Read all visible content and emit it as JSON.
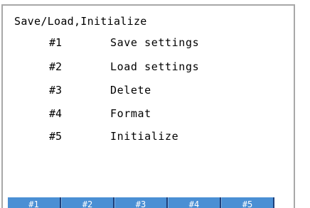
{
  "screen": {
    "title": "Save/Load,Initialize"
  },
  "menu": [
    {
      "number": "#1",
      "label": "Save settings"
    },
    {
      "number": "#2",
      "label": "Load settings"
    },
    {
      "number": "#3",
      "label": "Delete"
    },
    {
      "number": "#4",
      "label": "Format"
    },
    {
      "number": "#5",
      "label": "Initialize"
    }
  ],
  "softkeys": [
    "#1",
    "#2",
    "#3",
    "#4",
    "#5"
  ],
  "colors": {
    "softkey_background": "#4a8fd4",
    "softkey_text": "#ffffff",
    "frame": "#a8a8a8"
  }
}
